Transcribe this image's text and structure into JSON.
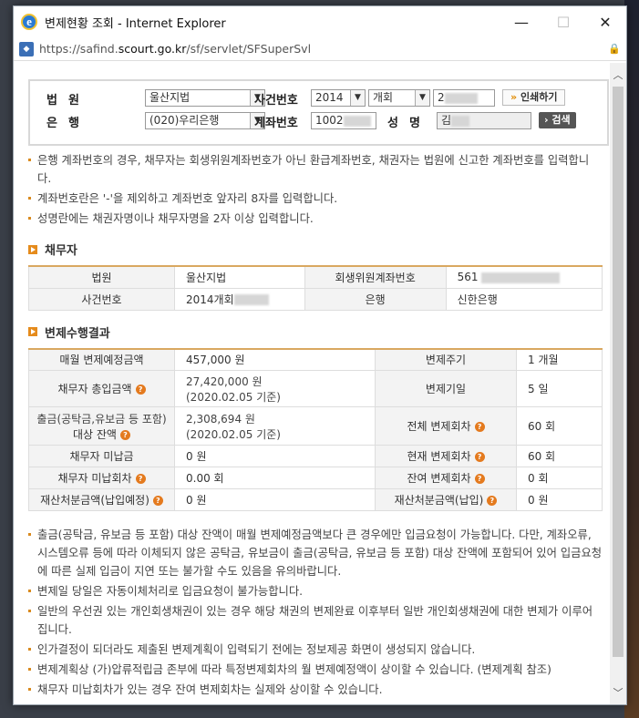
{
  "window": {
    "title": "변제현황 조회 - Internet Explorer",
    "url_prefix": "https://safind.",
    "url_domain": "scourt.go.kr",
    "url_path": "/sf/servlet/SFSuperSvl",
    "minimize": "—",
    "maximize": "☐",
    "close": "✕"
  },
  "search": {
    "court_label": "법원",
    "court_value": "울산지법",
    "case_label": "사건번호",
    "case_year": "2014",
    "case_type": "개회",
    "case_num": "2",
    "print_button": "인쇄하기",
    "bank_label": "은행",
    "bank_value": "(020)우리은행",
    "account_label": "계좌번호",
    "account_value": "1002",
    "name_label": "성명",
    "name_value": "김",
    "search_button": "검색"
  },
  "notes_top": [
    "은행 계좌번호의 경우, 채무자는 회생위원계좌번호가 아닌 환급계좌번호, 채권자는 법원에 신고한 계좌번호를 입력합니다.",
    "계좌번호란은 '-'을 제외하고 계좌번호 앞자리 8자를 입력합니다.",
    "성명란에는 채권자명이나 채무자명을 2자 이상 입력합니다."
  ],
  "debtor": {
    "section_title": "채무자",
    "court_h": "법원",
    "court_v": "울산지법",
    "account_h": "회생위원계좌번호",
    "account_v": "561",
    "case_h": "사건번호",
    "case_v": "2014개회",
    "bank_h": "은행",
    "bank_v": "신한은행"
  },
  "result": {
    "section_title": "변제수행결과",
    "monthly_h": "매월 변제예정금액",
    "monthly_v": "457,000 원",
    "cycle_h": "변제주기",
    "cycle_v": "1 개월",
    "total_in_h": "채무자 총입금액",
    "total_in_v": "27,420,000 원",
    "total_in_date": "(2020.02.05 기준)",
    "period_h": "변제기일",
    "period_v": "5 일",
    "payout_h1": "출금(공탁금,유보금 등 포함)",
    "payout_h2": "대상 잔액",
    "payout_v": "2,308,694 원",
    "payout_date": "(2020.02.05 기준)",
    "total_rounds_h": "전체 변제회차",
    "total_rounds_v": "60 회",
    "unpaid_h": "채무자 미납금",
    "unpaid_v": "0 원",
    "current_rounds_h": "현재 변제회차",
    "current_rounds_v": "60 회",
    "unpaid_rounds_h": "채무자 미납회차",
    "unpaid_rounds_v": "0.00 회",
    "remaining_rounds_h": "잔여 변제회차",
    "remaining_rounds_v": "0 회",
    "property_planned_h": "재산처분금액(납입예정)",
    "property_planned_v": "0 원",
    "property_paid_h": "재산처분금액(납입)",
    "property_paid_v": "0 원"
  },
  "notes_bottom": [
    "출금(공탁금, 유보금 등 포함) 대상 잔액이 매월 변제예정금액보다 큰 경우에만 입금요청이 가능합니다. 다만, 계좌오류, 시스템오류 등에 따라 이체되지 않은 공탁금, 유보금이 출금(공탁금, 유보금 등 포함) 대상 잔액에 포함되어 있어 입금요청에 따른 실제 입금이 지연 또는 불가할 수도 있음을 유의바랍니다.",
    "변제일 당일은 자동이체처리로 입금요청이 불가능합니다.",
    "일반의 우선권 있는 개인회생채권이 있는 경우 해당 채권의 변제완료 이후부터 일반 개인회생채권에 대한 변제가 이루어집니다.",
    "인가결정이 되더라도 제출된 변제계획이 입력되기 전에는 정보제공 화면이 생성되지 않습니다.",
    "변제계획상 (가)압류적립금 존부에 따라 특정변제회차의 월 변제예정액이 상이할 수 있습니다. (변제계획 참조)",
    "채무자 미납회차가 있는 경우 잔여 변제회차는 실제와 상이할 수 있습니다."
  ]
}
